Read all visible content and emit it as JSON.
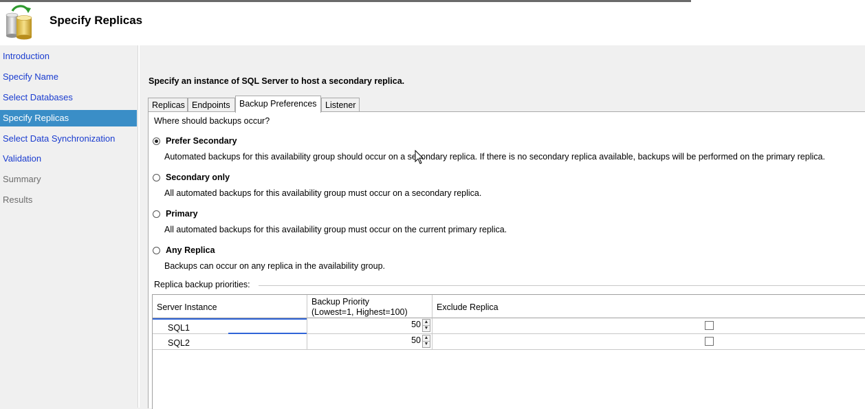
{
  "header": {
    "title": "Specify Replicas",
    "icon": "database-refresh-icon"
  },
  "sidebar": {
    "items": [
      {
        "label": "Introduction",
        "state": "link"
      },
      {
        "label": "Specify Name",
        "state": "link"
      },
      {
        "label": "Select Databases",
        "state": "link"
      },
      {
        "label": "Specify Replicas",
        "state": "selected"
      },
      {
        "label": "Select Data Synchronization",
        "state": "link"
      },
      {
        "label": "Validation",
        "state": "link"
      },
      {
        "label": "Summary",
        "state": "disabled"
      },
      {
        "label": "Results",
        "state": "disabled"
      }
    ],
    "selected_color": "#3a8ec7",
    "link_color": "#1a3ccf"
  },
  "main": {
    "instruction": "Specify an instance of SQL Server to host a secondary replica.",
    "tabs": [
      "Replicas",
      "Endpoints",
      "Backup Preferences",
      "Listener"
    ],
    "active_tab": "Backup Preferences",
    "question": "Where should backups occur?",
    "options": [
      {
        "label": "Prefer Secondary",
        "checked": true,
        "description": "Automated backups for this availability group should occur on a secondary replica. If there is no secondary replica available, backups will be performed on the primary replica."
      },
      {
        "label": "Secondary only",
        "checked": false,
        "description": "All automated backups for this availability group must occur on a secondary replica."
      },
      {
        "label": "Primary",
        "checked": false,
        "description": "All automated backups for this availability group must occur on the current primary replica."
      },
      {
        "label": "Any Replica",
        "checked": false,
        "description": "Backups can occur on any replica in the availability group."
      }
    ],
    "priorities": {
      "title": "Replica backup priorities:",
      "columns": [
        "Server Instance",
        "Backup Priority\n(Lowest=1, Highest=100)",
        "Exclude Replica"
      ],
      "col_server": "Server Instance",
      "col_priority_1": "Backup Priority",
      "col_priority_2": "(Lowest=1, Highest=100)",
      "col_exclude": "Exclude Replica",
      "rows": [
        {
          "server": "SQL1",
          "priority": "50",
          "exclude": false
        },
        {
          "server": "SQL2",
          "priority": "50",
          "exclude": false
        }
      ]
    }
  }
}
